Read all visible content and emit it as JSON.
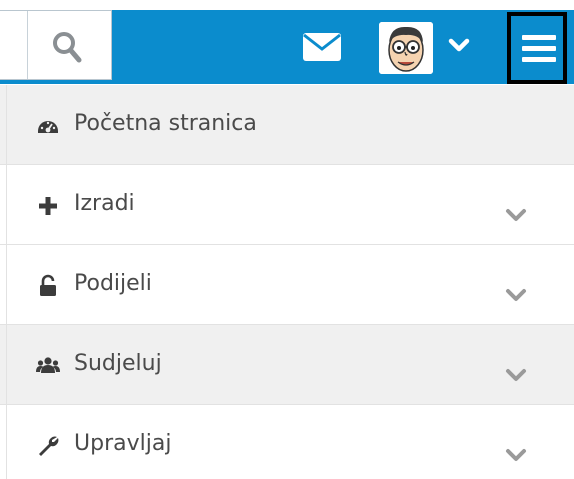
{
  "header": {
    "accent_color": "#0b8ccd",
    "search_icon": "search-icon",
    "messages_icon": "envelope-icon",
    "user_menu_icon": "chevron-down-icon",
    "menu_icon": "hamburger-icon"
  },
  "nav": {
    "items": [
      {
        "label": "Početna stranica",
        "icon": "dashboard-icon",
        "expandable": false
      },
      {
        "label": "Izradi",
        "icon": "plus-icon",
        "expandable": true
      },
      {
        "label": "Podijeli",
        "icon": "unlock-icon",
        "expandable": true
      },
      {
        "label": "Sudjeluj",
        "icon": "users-icon",
        "expandable": true
      },
      {
        "label": "Upravljaj",
        "icon": "wrench-icon",
        "expandable": true
      }
    ]
  }
}
